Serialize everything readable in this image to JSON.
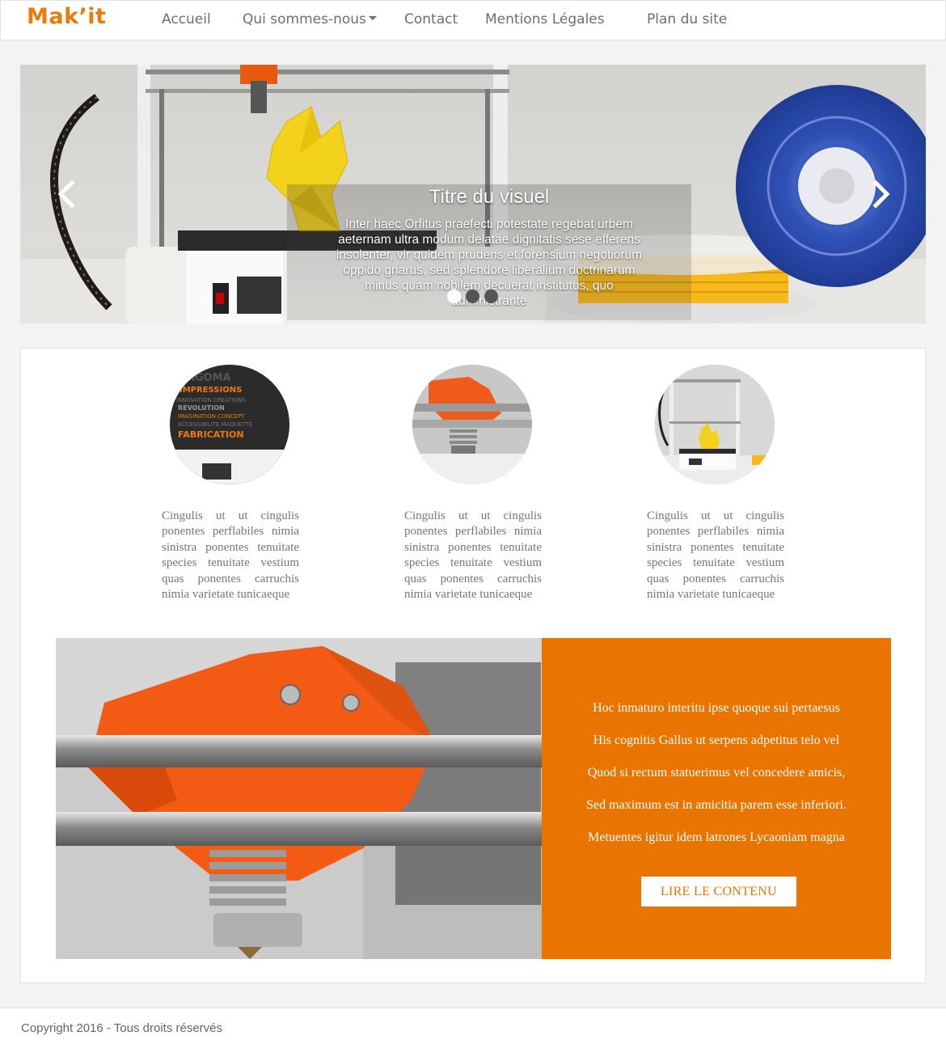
{
  "brand": {
    "name": "Mak’it",
    "color": "#ea7a0a"
  },
  "nav": {
    "items": [
      {
        "label": "Accueil"
      },
      {
        "label": "Qui sommes-nous"
      },
      {
        "label": "Contact"
      },
      {
        "label": "Mentions Légales"
      },
      {
        "label": "Plan du site"
      }
    ]
  },
  "carousel": {
    "title": "Titre du visuel",
    "text": "Inter haec Orfitus praefecti potestate regebat urbem aeternam ultra modum delatae dignitatis sese efferens insolenter, vir quidem prudens et forensium negotiorum oppido gnarus, sed splendore liberalium doctrinarum minus quam nobilem decuerat institutus, quo administrante",
    "prev_icon": "chevron-left-icon",
    "next_icon": "chevron-right-icon",
    "slides_count": 3,
    "active_slide": 1
  },
  "features": [
    {
      "image": "fabrication-text-image",
      "text": "Cingulis ut ut cingulis ponentes perflabiles nimia sinistra ponentes tenuitate species tenuitate vestium quas ponentes carruchis nimia varietate tunicaeque"
    },
    {
      "image": "printer-head-image",
      "text": "Cingulis ut ut cingulis ponentes perflabiles nimia sinistra ponentes tenuitate species tenuitate vestium quas ponentes carruchis nimia varietate tunicaeque"
    },
    {
      "image": "printer-bunny-image",
      "text": "Cingulis ut ut cingulis ponentes perflabiles nimia sinistra ponentes tenuitate species tenuitate vestium quas ponentes carruchis nimia varietate tunicaeque"
    }
  ],
  "promo": {
    "lines": [
      "Hoc inmaturo interitu ipse quoque sui pertaesus",
      "His cognitis Gallus ut serpens adpetitus telo vel",
      "Quod si rectum statuerimus vel concedere amicis,",
      "Sed maximum est in amicitia parem esse inferiori.",
      "Metuentes igitur idem latrones Lycaoniam magna"
    ],
    "button_label": "LIRE LE CONTENU",
    "accent_color": "#ea7400"
  },
  "footer": {
    "text": "Copyright 2016 - Tous droits réservés"
  }
}
